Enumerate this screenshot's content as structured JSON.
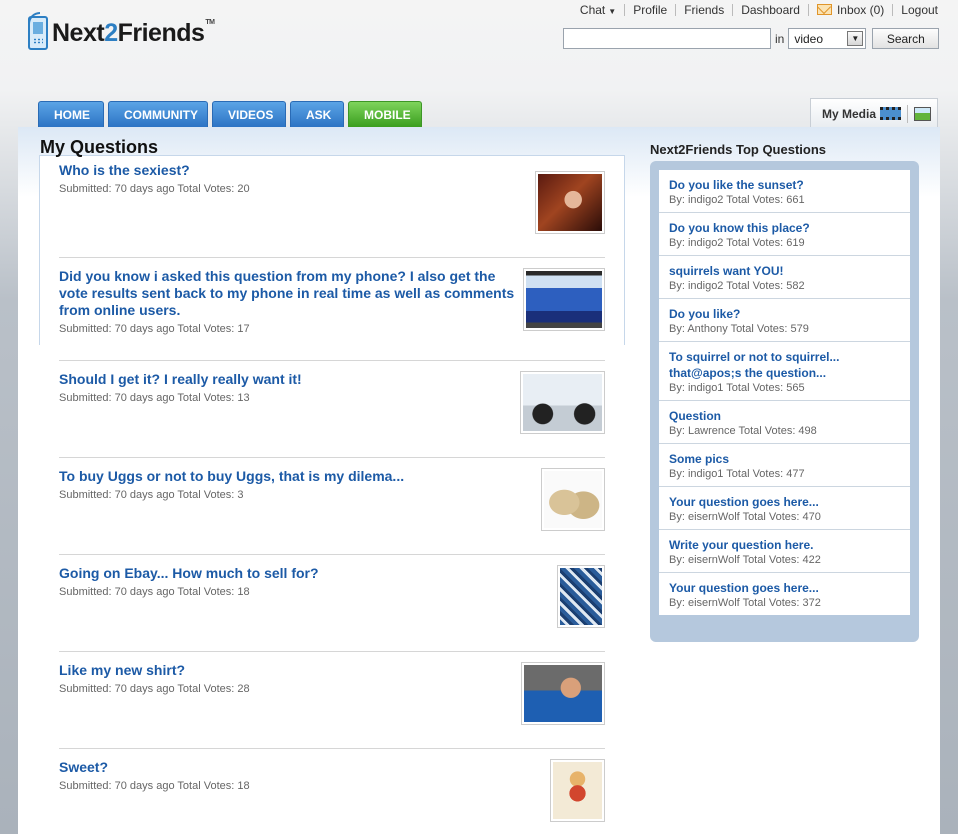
{
  "brand": {
    "name_prefix": "Next",
    "name_two": "2",
    "name_suffix": "Friends",
    "tm": "TM"
  },
  "topnav": {
    "chat": "Chat",
    "profile": "Profile",
    "friends": "Friends",
    "dashboard": "Dashboard",
    "inbox": "Inbox (0)",
    "logout": "Logout"
  },
  "search": {
    "in_label": "in",
    "type_value": "video",
    "button": "Search",
    "value": ""
  },
  "tabs": [
    "HOME",
    "COMMUNITY",
    "VIDEOS",
    "ASK",
    "MOBILE"
  ],
  "my_media": "My Media",
  "main": {
    "title": "My Questions",
    "questions": [
      {
        "title": "Who is the sexiest?",
        "meta": "Submitted: 70 days ago Total Votes: 20"
      },
      {
        "title": "Did you know i asked this question from my phone? I also get the vote results sent back to my phone in real time as well as comments from online users.",
        "meta": "Submitted: 70 days ago Total Votes: 17"
      },
      {
        "title": "Should I get it? I really really want it!",
        "meta": "Submitted: 70 days ago Total Votes: 13"
      },
      {
        "title": "To buy Uggs or not to buy Uggs, that is my dilema...",
        "meta": "Submitted: 70 days ago Total Votes: 3"
      },
      {
        "title": "Going on Ebay... How much to sell for?",
        "meta": "Submitted: 70 days ago Total Votes: 18"
      },
      {
        "title": "Like my new shirt?",
        "meta": "Submitted: 70 days ago Total Votes: 28"
      },
      {
        "title": "Sweet?",
        "meta": "Submitted: 70 days ago Total Votes: 18"
      }
    ]
  },
  "sidebar": {
    "title": "Next2Friends Top Questions",
    "items": [
      {
        "title": "Do you like the sunset?",
        "meta": "By: indigo2 Total Votes: 661"
      },
      {
        "title": "Do you know this place?",
        "meta": "By: indigo2 Total Votes: 619"
      },
      {
        "title": "squirrels want YOU!",
        "meta": "By: indigo2 Total Votes: 582"
      },
      {
        "title": "Do you like?",
        "meta": "By: Anthony Total Votes: 579"
      },
      {
        "title": "To squirrel or not to squirrel... that@apos;s the question...",
        "meta": "By: indigo1 Total Votes: 565"
      },
      {
        "title": "Question",
        "meta": "By: Lawrence Total Votes: 498"
      },
      {
        "title": "Some pics",
        "meta": "By: indigo1 Total Votes: 477"
      },
      {
        "title": "Your question goes here...",
        "meta": "By: eisernWolf Total Votes: 470"
      },
      {
        "title": "Write your question here.",
        "meta": "By: eisernWolf Total Votes: 422"
      },
      {
        "title": "Your question goes here...",
        "meta": "By: eisernWolf Total Votes: 372"
      }
    ]
  },
  "colors": {
    "link": "#1c5aa6",
    "tab_blue": "#2c73c4",
    "tab_green": "#3a9e1e",
    "panel": "#b5c8dd"
  }
}
